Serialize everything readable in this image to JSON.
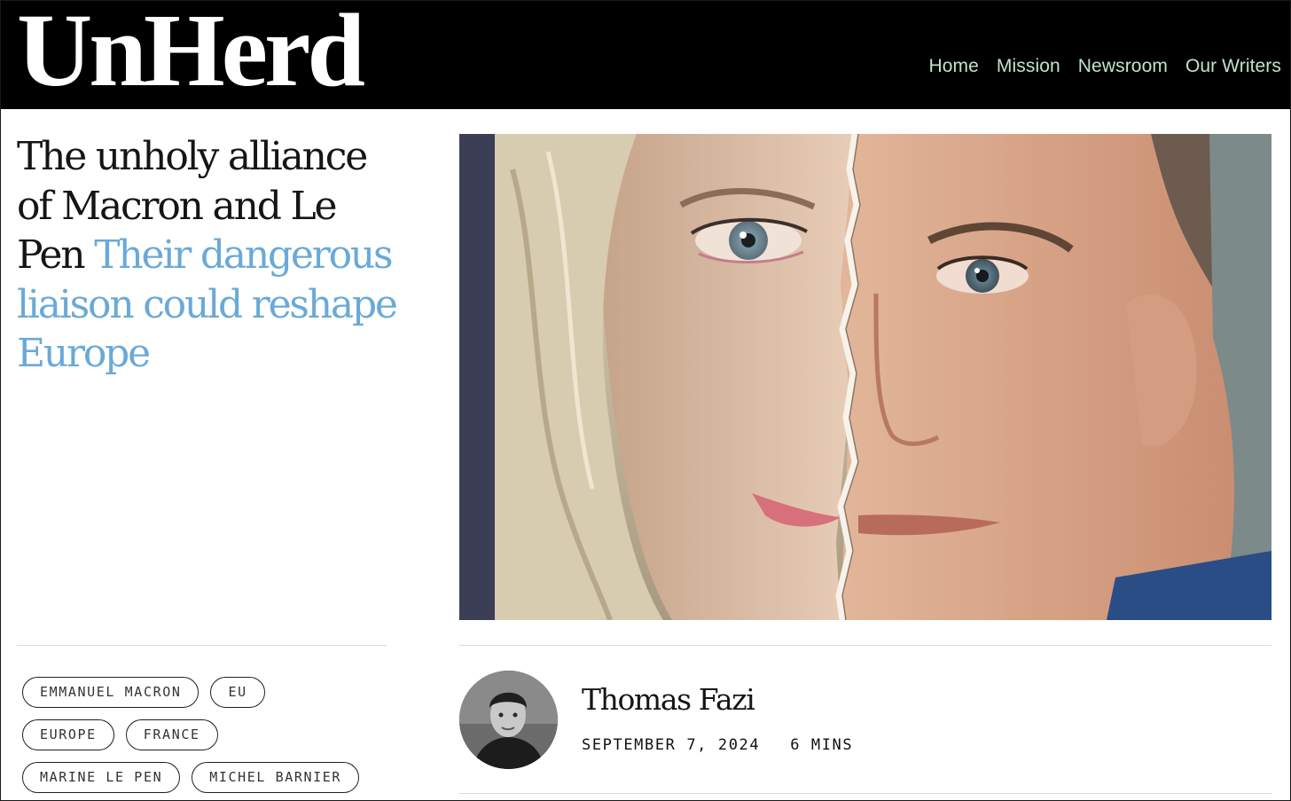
{
  "site": {
    "logo": "UnHerd",
    "nav": [
      "Home",
      "Mission",
      "Newsroom",
      "Our Writers"
    ]
  },
  "article": {
    "title": "The unholy alliance of Macron and Le Pen",
    "subtitle": "Their dangerous liaison could reshape Europe",
    "tags": [
      "EMMANUEL MACRON",
      "EU",
      "EUROPE",
      "FRANCE",
      "MARINE LE PEN",
      "MICHEL BARNIER"
    ],
    "author": "Thomas Fazi",
    "date": "SEPTEMBER 7, 2024",
    "read_time": "6 MINS"
  },
  "colors": {
    "header_bg": "#000000",
    "nav_text": "#bfe3cc",
    "subtitle_blue": "#6aa9d8",
    "text_dark": "#151515"
  }
}
